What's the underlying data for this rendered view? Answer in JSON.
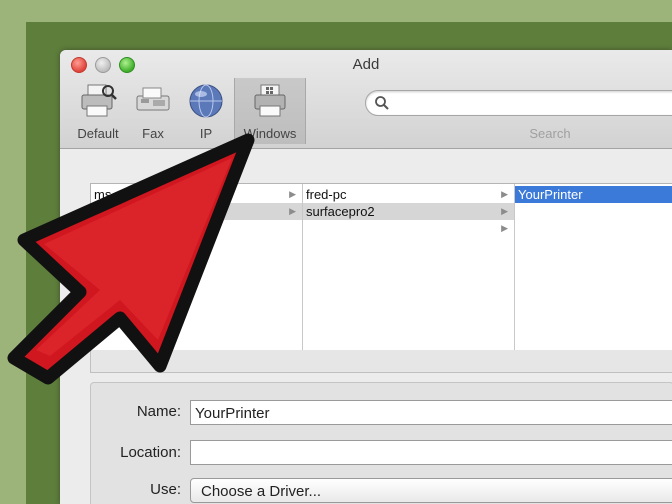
{
  "window": {
    "title": "Add"
  },
  "toolbar": {
    "buttons": [
      {
        "label": "Default",
        "icon": "printer-icon"
      },
      {
        "label": "Fax",
        "icon": "fax-icon"
      },
      {
        "label": "IP",
        "icon": "globe-icon"
      },
      {
        "label": "Windows",
        "icon": "printer-icon",
        "selected": true
      }
    ],
    "search": {
      "placeholder": "",
      "label": "Search"
    }
  },
  "browser": {
    "column1": [
      {
        "label": "ms"
      },
      {
        "label": ""
      }
    ],
    "column2": [
      {
        "label": "fred-pc"
      },
      {
        "label": "surfacepro2",
        "selected": true
      }
    ],
    "column3": [
      {
        "label": "YourPrinter",
        "selected": true
      }
    ]
  },
  "form": {
    "name": {
      "label": "Name:",
      "value": "YourPrinter"
    },
    "location": {
      "label": "Location:",
      "value": ""
    },
    "use": {
      "label": "Use:",
      "value": "Choose a Driver..."
    }
  },
  "colors": {
    "background_outer": "#9cb47a",
    "background_inner": "#5e7e3c",
    "selection_blue": "#3b7ad9",
    "arrow_red": "#d0161e"
  }
}
